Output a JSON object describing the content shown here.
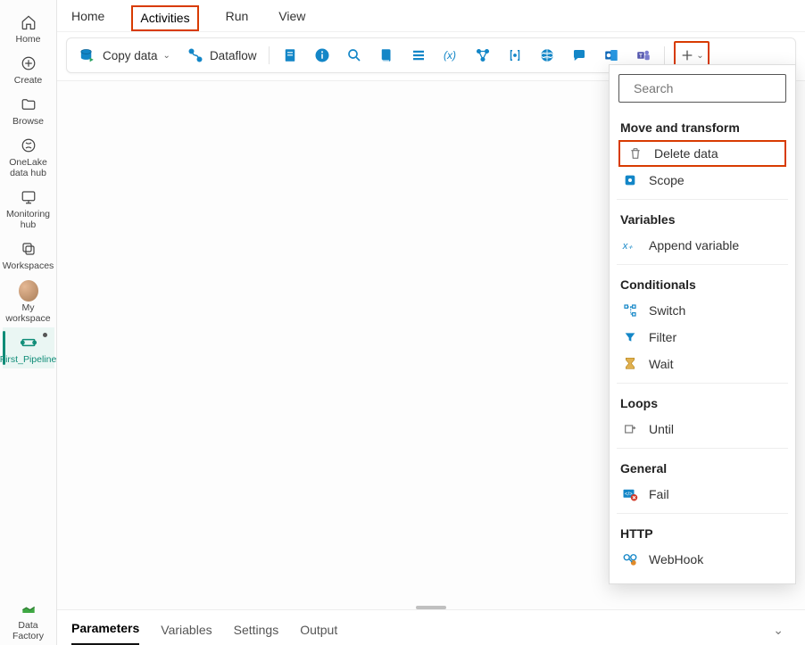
{
  "sidebar": {
    "items": [
      {
        "label": "Home"
      },
      {
        "label": "Create"
      },
      {
        "label": "Browse"
      },
      {
        "label": "OneLake data hub"
      },
      {
        "label": "Monitoring hub"
      },
      {
        "label": "Workspaces"
      },
      {
        "label": "My workspace"
      },
      {
        "label": "First_Pipeline"
      }
    ],
    "footer": "Data Factory"
  },
  "tabs": {
    "items": [
      "Home",
      "Activities",
      "Run",
      "View"
    ],
    "active": "Activities"
  },
  "toolbar": {
    "copy_data": "Copy data",
    "dataflow": "Dataflow"
  },
  "panel": {
    "search_placeholder": "Search",
    "groups": [
      {
        "title": "Move and transform",
        "items": [
          {
            "label": "Delete data",
            "highlighted": true,
            "icon": "trash"
          },
          {
            "label": "Scope",
            "icon": "scope"
          }
        ]
      },
      {
        "title": "Variables",
        "items": [
          {
            "label": "Append variable",
            "icon": "var-plus"
          }
        ]
      },
      {
        "title": "Conditionals",
        "items": [
          {
            "label": "Switch",
            "icon": "switch"
          },
          {
            "label": "Filter",
            "icon": "filter"
          },
          {
            "label": "Wait",
            "icon": "wait"
          }
        ]
      },
      {
        "title": "Loops",
        "items": [
          {
            "label": "Until",
            "icon": "until"
          }
        ]
      },
      {
        "title": "General",
        "items": [
          {
            "label": "Fail",
            "icon": "fail"
          }
        ]
      },
      {
        "title": "HTTP",
        "items": [
          {
            "label": "WebHook",
            "icon": "webhook"
          }
        ]
      }
    ]
  },
  "bottom_tabs": {
    "items": [
      "Parameters",
      "Variables",
      "Settings",
      "Output"
    ],
    "active": "Parameters"
  }
}
